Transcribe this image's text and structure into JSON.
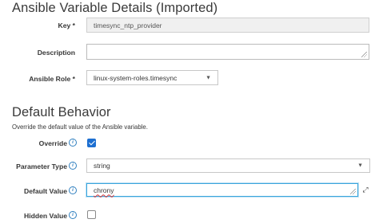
{
  "section1": {
    "title": "Ansible Variable Details (Imported)",
    "key_label": "Key *",
    "key_value": "timesync_ntp_provider",
    "description_label": "Description",
    "description_value": "",
    "role_label": "Ansible Role *",
    "role_value": "linux-system-roles.timesync"
  },
  "section2": {
    "title": "Default Behavior",
    "subtitle": "Override the default value of the Ansible variable.",
    "override_label": "Override",
    "override_checked": true,
    "param_type_label": "Parameter Type",
    "param_type_value": "string",
    "default_value_label": "Default Value",
    "default_value": "chrony",
    "hidden_value_label": "Hidden Value",
    "hidden_checked": false
  },
  "icons": {
    "info": "info-icon",
    "caret": "caret-down-icon",
    "expand": "expand-icon",
    "resize": "resize-grip-icon"
  },
  "colors": {
    "accent": "#1d6fd1",
    "info": "#2f7fbf",
    "focus": "#39a5dc",
    "readonly_bg": "#f0f0f0"
  }
}
